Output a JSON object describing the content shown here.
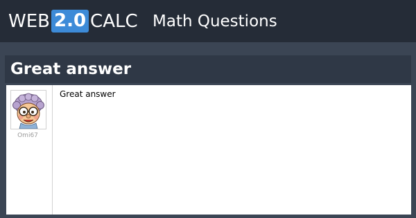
{
  "header": {
    "logo": {
      "left": "WEB",
      "version": "2.0",
      "right": "CALC"
    },
    "section_title": "Math Questions"
  },
  "page": {
    "title": "Great answer"
  },
  "answer": {
    "username": "Omi67",
    "text": "Great answer",
    "avatar_icon": "grandma-avatar-icon"
  },
  "colors": {
    "header_bg": "#252c37",
    "page_bg": "#3b4554",
    "title_bg": "#2f3846",
    "logo_accent": "#3d8bd8",
    "content_bg": "#ffffff"
  }
}
